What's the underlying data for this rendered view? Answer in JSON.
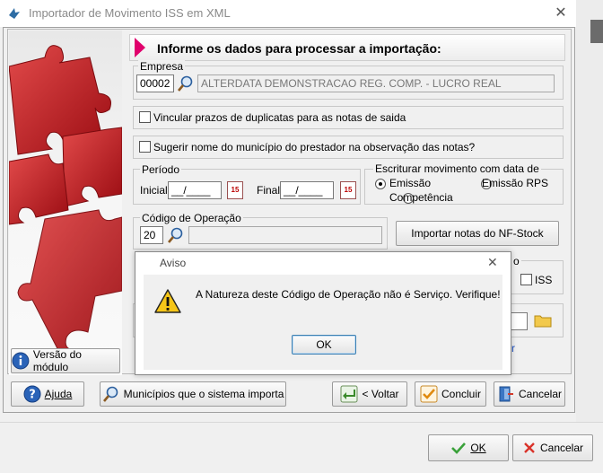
{
  "window": {
    "title": "Importador de Movimento ISS em XML",
    "close_glyph": "✕"
  },
  "header": {
    "title": "Informe os dados para processar a importação:"
  },
  "empresa": {
    "label": "Empresa",
    "code": "00002",
    "name": "ALTERDATA DEMONSTRACAO REG. COMP. - LUCRO REAL"
  },
  "options": {
    "vincular": "Vincular prazos de duplicatas para as notas de saida",
    "sugerir": "Sugerir nome do município do prestador na observação das notas?"
  },
  "periodo": {
    "label": "Período",
    "inicial_label": "Inicial",
    "inicial_value": "__/____",
    "final_label": "Final",
    "final_value": "__/____",
    "cal_text": "15"
  },
  "escriturar": {
    "label": "Escriturar movimento com data de",
    "emissao": "Emissão",
    "emissao_rps": "Emissão RPS",
    "competencia": "Competência"
  },
  "codigo": {
    "label": "Código de Operação",
    "value": "20",
    "desc": ""
  },
  "buttons": {
    "importar_nfstock": "Importar notas do NF-Stock",
    "versao": "Versão do módulo",
    "ajuda": "Ajuda",
    "municipios": "Municípios que o sistema importa",
    "voltar": "< Voltar",
    "concluir": "Concluir",
    "cancelar": "Cancelar"
  },
  "partial": {
    "iss": "ISS",
    "o_fragment": "o",
    "r_fragment": "r"
  },
  "modal": {
    "title": "Aviso",
    "message": "A Natureza deste Código de Operação não é Serviço. Verifique!",
    "ok": "OK",
    "close_glyph": "✕"
  },
  "outer_buttons": {
    "ok": "OK",
    "cancelar": "Cancelar"
  },
  "colors": {
    "accent": "#e0006c",
    "puzzle_red": "#c8101a",
    "ok_green": "#3aa13a",
    "cancel_red": "#d9332a"
  }
}
